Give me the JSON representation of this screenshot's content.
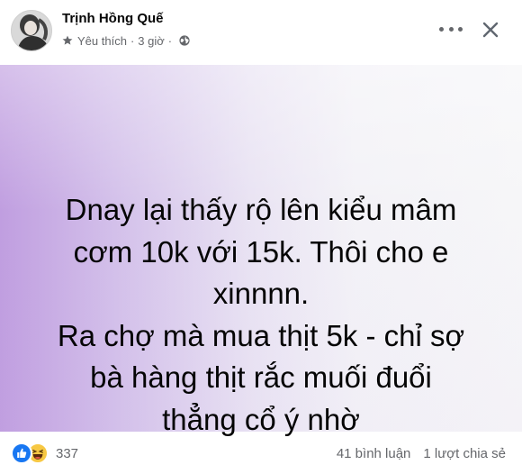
{
  "post": {
    "author": "Trịnh Hồng Quế",
    "meta": {
      "privacy_label": "Yêu thích",
      "time": "3 giờ",
      "separator": "·"
    },
    "text_lines": [
      "Dnay lại thấy rộ lên kiểu mâm",
      "cơm 10k với 15k. Thôi cho e",
      "xinnnn.",
      "Ra chợ mà mua thịt 5k - chỉ sợ",
      "bà hàng thịt rắc muối đuổi",
      "thẳng cổ ý nhờ"
    ],
    "background_colors": [
      "#c09ee0",
      "#f6f6f8"
    ]
  },
  "footer": {
    "reaction_count": "337",
    "comments": "41 bình luận",
    "shares": "1 lượt chia sẻ"
  },
  "icons": {
    "star": "star-icon",
    "globe": "globe-icon",
    "more": "more-options-icon",
    "close": "close-icon",
    "like": "like-reaction-icon",
    "haha": "haha-reaction-icon"
  },
  "colors": {
    "like_blue": "#1877f2",
    "haha_yellow": "#f7c843",
    "secondary_text": "#65676b",
    "primary_text": "#050505"
  }
}
